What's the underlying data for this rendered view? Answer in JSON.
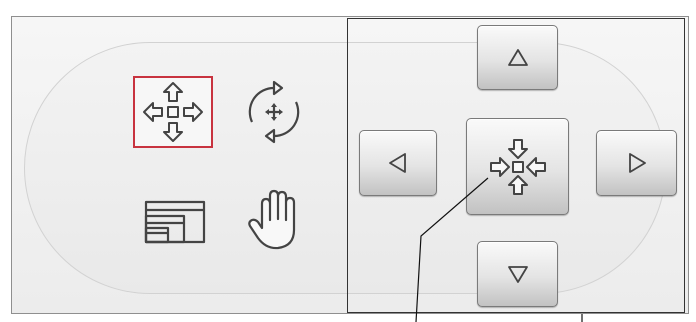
{
  "modes": [
    {
      "id": "move",
      "icon": "move-arrows-icon",
      "selected": true
    },
    {
      "id": "rotate",
      "icon": "rotate-icon",
      "selected": false
    },
    {
      "id": "fit",
      "icon": "fit-windows-icon",
      "selected": false
    },
    {
      "id": "pan",
      "icon": "hand-icon",
      "selected": false
    }
  ],
  "pad": {
    "up": {
      "icon": "triangle-up-icon"
    },
    "left": {
      "icon": "triangle-left-icon"
    },
    "center": {
      "icon": "center-arrows-icon"
    },
    "right": {
      "icon": "triangle-right-icon"
    },
    "down": {
      "icon": "triangle-down-icon"
    }
  },
  "colors": {
    "selection": "#c8333f",
    "icon_stroke": "#444444",
    "frame": "#333333"
  }
}
